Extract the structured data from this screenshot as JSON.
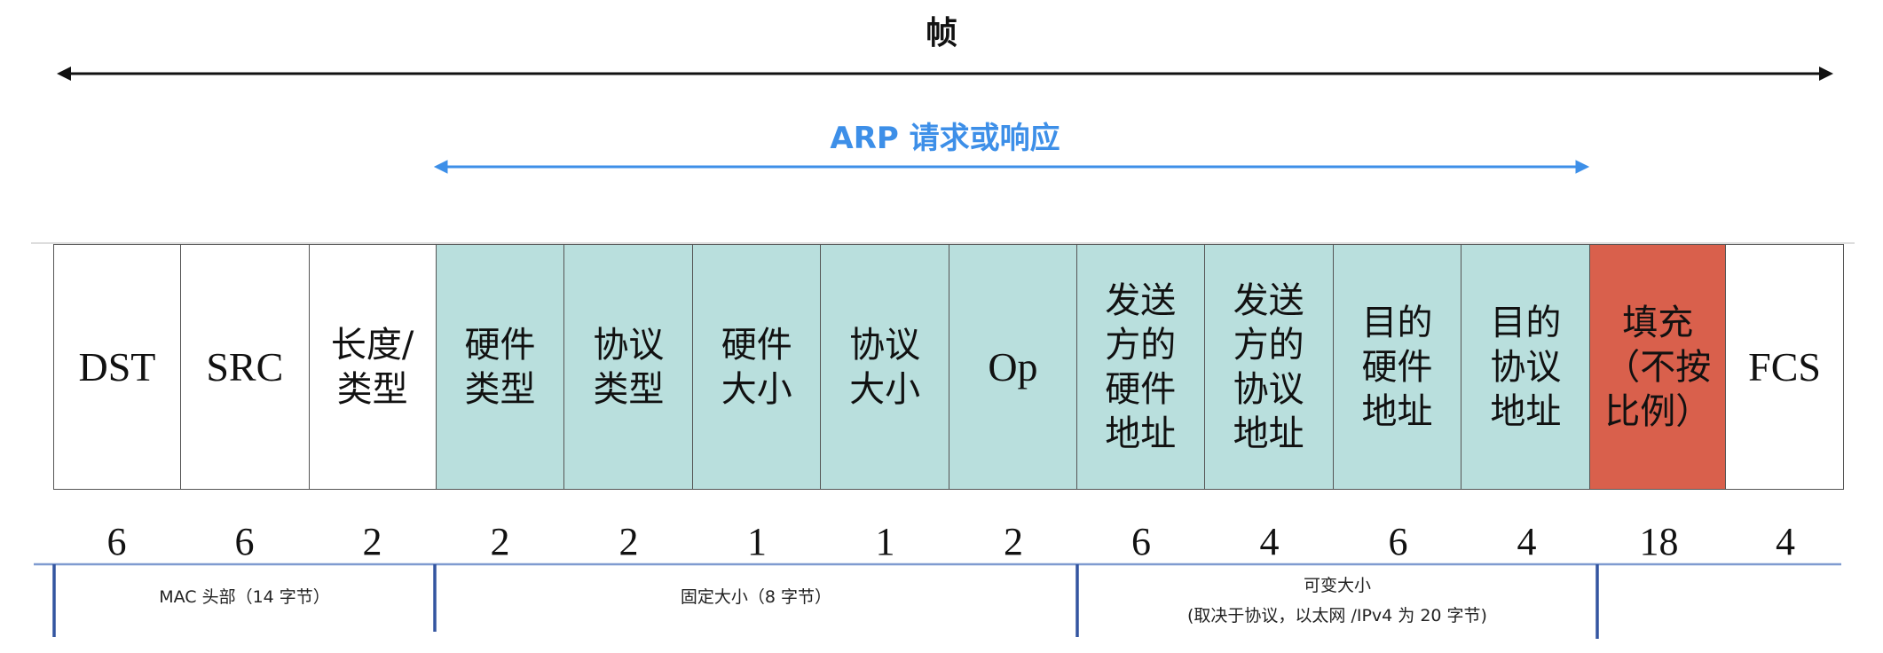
{
  "frame_label": "帧",
  "arp_label": "ARP 请求或响应",
  "colors": {
    "teal": "#b9dfdd",
    "red": "#d9604c",
    "white": "#ffffff",
    "blue_arrow": "#3d8fe8",
    "group_line": "#3355a0"
  },
  "fields": [
    {
      "label": "DST",
      "size": "6",
      "color": "white"
    },
    {
      "label": "SRC",
      "size": "6",
      "color": "white"
    },
    {
      "label": "长度/\n类型",
      "size": "2",
      "color": "white"
    },
    {
      "label": "硬件\n类型",
      "size": "2",
      "color": "teal"
    },
    {
      "label": "协议\n类型",
      "size": "2",
      "color": "teal"
    },
    {
      "label": "硬件\n大小",
      "size": "1",
      "color": "teal"
    },
    {
      "label": "协议\n大小",
      "size": "1",
      "color": "teal"
    },
    {
      "label": "Op",
      "size": "2",
      "color": "teal"
    },
    {
      "label": "发送\n方的\n硬件\n地址",
      "size": "6",
      "color": "teal"
    },
    {
      "label": "发送\n方的\n协议\n地址",
      "size": "4",
      "color": "teal"
    },
    {
      "label": "目的\n硬件\n地址",
      "size": "6",
      "color": "teal"
    },
    {
      "label": "目的\n协议\n地址",
      "size": "4",
      "color": "teal"
    },
    {
      "label": "填充\n（不按\n比例）",
      "size": "18",
      "color": "red"
    },
    {
      "label": "FCS",
      "size": "4",
      "color": "white"
    }
  ],
  "groups": [
    {
      "label": "MAC 头部（14 字节）"
    },
    {
      "label": "固定大小（8 字节）"
    },
    {
      "label": "可变大小\n(取决于协议，以太网 /IPv4 为 20 字节)"
    }
  ]
}
